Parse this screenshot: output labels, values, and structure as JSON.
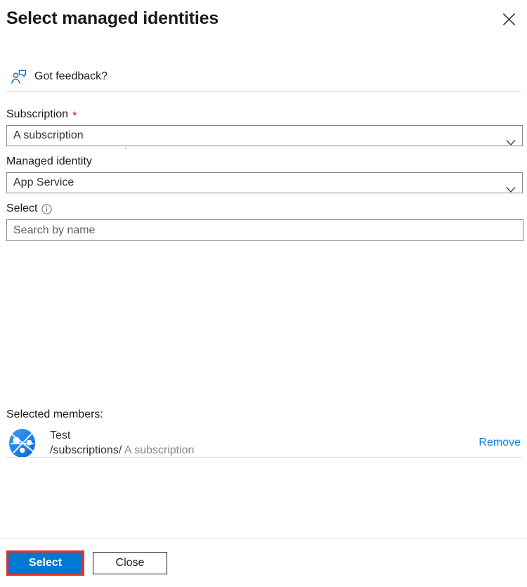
{
  "dialog": {
    "title": "Select managed identities",
    "close_label": "Close dialog",
    "close_icon": "close-icon"
  },
  "feedback": {
    "label": "Got feedback?",
    "icon": "feedback-person-icon",
    "accent_color": "#0f6cbd"
  },
  "form": {
    "subscription": {
      "label": "Subscription",
      "required_marker": "*",
      "value": "A subscription",
      "chevron_icon": "chevron-down-icon"
    },
    "managed_identity": {
      "label": "Managed identity",
      "value": "App Service",
      "chevron_icon": "chevron-down-icon"
    },
    "select": {
      "label": "Select",
      "info_icon": "info-circle-icon",
      "placeholder": "Search by name",
      "value": ""
    }
  },
  "selected_members": {
    "heading": "Selected members:",
    "items": [
      {
        "avatar_icon": "app-service-icon",
        "name": "Test",
        "path": "/subscriptions/",
        "scope": "A subscription",
        "remove_label": "Remove"
      }
    ]
  },
  "footer": {
    "select_label": "Select",
    "close_label": "Close",
    "primary_color": "#0078d4",
    "highlight_color": "#ec2f23"
  }
}
